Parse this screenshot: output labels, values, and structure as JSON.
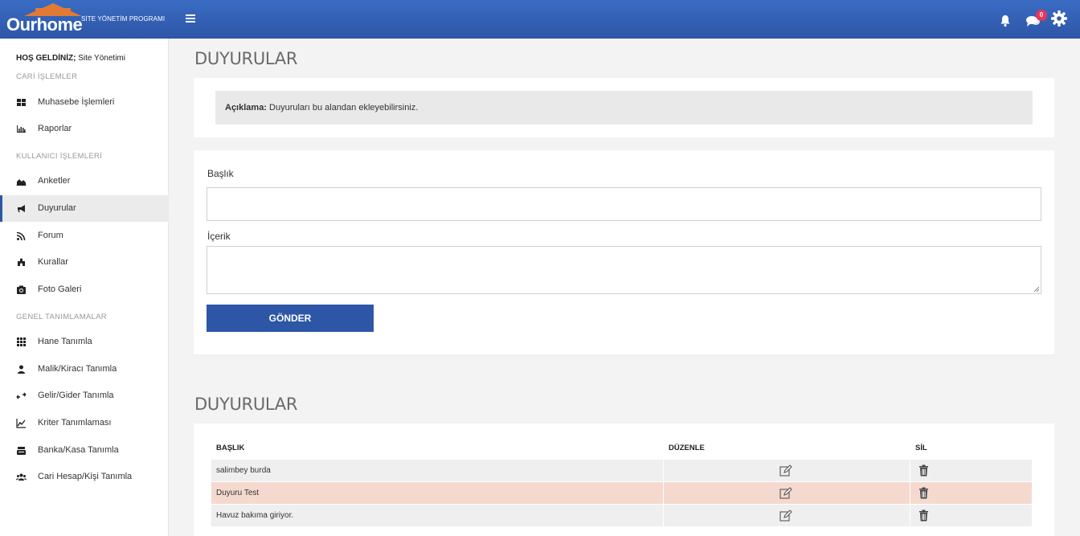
{
  "brand": {
    "name": "Ourhome",
    "subtitle": "SİTE YÖNETİM PROGRAMI",
    "accent": "#e07a34",
    "header_color": "#2d56a7"
  },
  "header": {
    "menu_icon": "hamburger-icon",
    "notification_icon": "bell-icon",
    "chat_icon": "chat-icon",
    "chat_badge": "0",
    "settings_icon": "gear-icon"
  },
  "sidebar": {
    "welcome_bold": "HOŞ GELDİNİZ;",
    "welcome_user": " Site Yönetimi",
    "sections": [
      "CARİ İŞLEMLER",
      "KULLANICI İŞLEMLERİ",
      "GENEL TANIMLAMALAR"
    ],
    "items": [
      {
        "label": "Muhasebe İşlemleri",
        "icon": "dashboard-icon"
      },
      {
        "label": "Raporlar",
        "icon": "bar-chart-icon"
      },
      {
        "label": "Anketler",
        "icon": "area-chart-icon"
      },
      {
        "label": "Duyurular",
        "icon": "megaphone-icon",
        "active": true
      },
      {
        "label": "Forum",
        "icon": "rss-icon"
      },
      {
        "label": "Kurallar",
        "icon": "puzzle-icon"
      },
      {
        "label": "Foto Galeri",
        "icon": "camera-icon"
      },
      {
        "label": "Hane Tanımla",
        "icon": "grid-icon"
      },
      {
        "label": "Malik/Kiracı Tanımla",
        "icon": "user-icon"
      },
      {
        "label": "Gelir/Gider Tanımla",
        "icon": "exchange-icon"
      },
      {
        "label": "Kriter Tanımlaması",
        "icon": "line-chart-icon"
      },
      {
        "label": "Banka/Kasa Tanımla",
        "icon": "bank-icon"
      },
      {
        "label": "Cari Hesap/Kişi Tanımla",
        "icon": "users-icon"
      }
    ]
  },
  "main": {
    "page_title": "DUYURULAR",
    "info_bold": "Açıklama:",
    "info_text": " Duyuruları bu alandan ekleyebilirsiniz.",
    "form": {
      "title_label": "Başlık",
      "title_value": "",
      "content_label": "İçerik",
      "content_value": "",
      "submit_label": "GÖNDER"
    },
    "list_title": "DUYURULAR",
    "table": {
      "columns": [
        "BAŞLIK",
        "DÜZENLE",
        "SİL"
      ],
      "rows": [
        {
          "title": "salimbey burda"
        },
        {
          "title": "Duyuru Test"
        },
        {
          "title": "Havuz bakıma giriyor."
        }
      ]
    }
  }
}
